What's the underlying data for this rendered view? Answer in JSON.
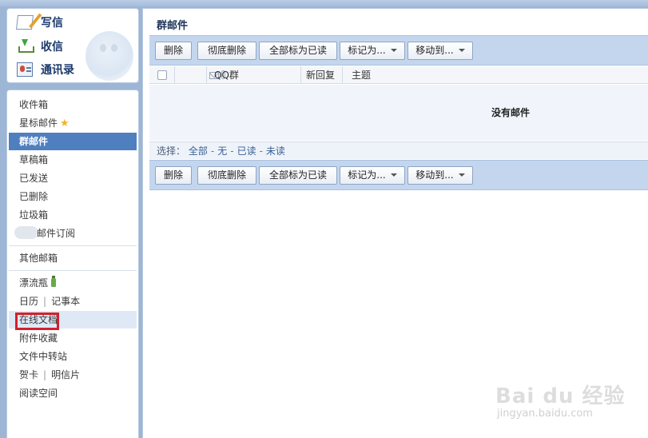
{
  "quick_nav": [
    {
      "label": "写信",
      "icon": "write-icon"
    },
    {
      "label": "收信",
      "icon": "receive-icon"
    },
    {
      "label": "通讯录",
      "icon": "contacts-icon"
    }
  ],
  "folders": {
    "inbox": "收件箱",
    "starred": "星标邮件",
    "group_mail": "群邮件",
    "drafts": "草稿箱",
    "sent": "已发送",
    "deleted": "已删除",
    "junk": "垃圾箱",
    "subscription": "邮件订阅"
  },
  "other_mailbox": "其他邮箱",
  "apps": {
    "drift_bottle": "漂流瓶",
    "calendar": "日历",
    "notepad": "记事本",
    "online_docs": "在线文档",
    "attachments": "附件收藏",
    "file_transfer": "文件中转站",
    "greeting_card": "贺卡",
    "postcard": "明信片",
    "reading_space": "阅读空间",
    "separator": "|"
  },
  "main": {
    "title": "群邮件",
    "toolbar": {
      "delete": "删除",
      "permanent_delete": "彻底删除",
      "mark_all_read": "全部标为已读",
      "mark_as": "标记为...",
      "move_to": "移动到..."
    },
    "columns": {
      "qq_group": "QQ群",
      "new_reply": "新回复",
      "subject": "主题"
    },
    "empty_message": "没有邮件",
    "select": {
      "label": "选择：",
      "all": "全部",
      "none": "无",
      "read": "已读",
      "unread": "未读",
      "dash": "-"
    }
  },
  "watermark": {
    "brand": "Bai du 经验",
    "url": "jingyan.baidu.com"
  },
  "colors": {
    "active_bg": "#4f7fbf",
    "toolbar_bg": "#c4d6ee",
    "highlight_box": "#d3202e"
  }
}
